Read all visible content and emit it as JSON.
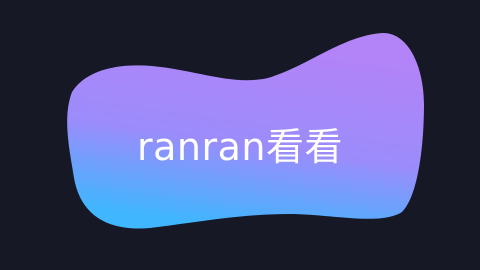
{
  "background_color": "#161826",
  "blob": {
    "gradient_top_color": "#b383f8",
    "gradient_mid_color": "#9c8cfb",
    "gradient_bottom_color": "#3fb6fe",
    "label": "ranran看看"
  }
}
